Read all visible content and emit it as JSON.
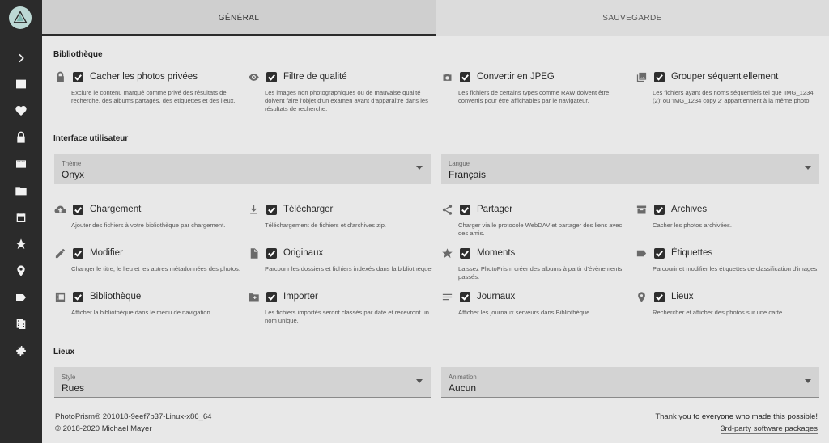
{
  "tabs": [
    {
      "label": "GÉNÉRAL",
      "active": true
    },
    {
      "label": "SAUVEGARDE",
      "active": false
    }
  ],
  "sidebar": {
    "items": [
      "chevron-right-icon",
      "photo-icon",
      "heart-icon",
      "lock-icon",
      "movie-icon",
      "folder-icon",
      "calendar-icon",
      "star-icon",
      "place-icon",
      "label-icon",
      "film-icon",
      "gear-icon"
    ]
  },
  "library": {
    "title": "Bibliothèque",
    "options": [
      {
        "icon": "lock-icon",
        "label": "Cacher les photos privées",
        "checked": true,
        "desc": "Exclure le contenu marqué comme privé des résultats de recherche, des albums partagés, des étiquettes et des lieux."
      },
      {
        "icon": "eye-icon",
        "label": "Filtre de qualité",
        "checked": true,
        "desc": "Les images non photographiques ou de mauvaise qualité doivent faire l'objet d'un examen avant d'apparaître dans les résultats de recherche."
      },
      {
        "icon": "camera-icon",
        "label": "Convertir en JPEG",
        "checked": true,
        "desc": "Les fichiers de certains types comme RAW doivent être convertis pour être affichables par le navigateur."
      },
      {
        "icon": "photo-library-icon",
        "label": "Grouper séquentiellement",
        "checked": true,
        "desc": "Les fichiers ayant des noms séquentiels tel que 'IMG_1234 (2)' ou 'IMG_1234 copy 2' appartiennent à la même photo."
      }
    ]
  },
  "ui": {
    "title": "Interface utilisateur",
    "theme": {
      "label": "Thème",
      "value": "Onyx"
    },
    "language": {
      "label": "Langue",
      "value": "Français"
    },
    "options": [
      {
        "icon": "cloud-upload-icon",
        "label": "Chargement",
        "checked": true,
        "desc": "Ajouter des fichiers à votre bibliothèque par chargement."
      },
      {
        "icon": "download-icon",
        "label": "Télécharger",
        "checked": true,
        "desc": "Téléchargement de fichiers et d'archives zip."
      },
      {
        "icon": "share-icon",
        "label": "Partager",
        "checked": true,
        "desc": "Charger via le protocole WebDAV et partager des liens avec des amis."
      },
      {
        "icon": "archive-icon",
        "label": "Archives",
        "checked": true,
        "desc": "Cacher les photos archivées."
      },
      {
        "icon": "edit-icon",
        "label": "Modifier",
        "checked": true,
        "desc": "Changer le titre, le lieu et les autres métadonnées des photos."
      },
      {
        "icon": "file-icon",
        "label": "Originaux",
        "checked": true,
        "desc": "Parcourir les dossiers et fichiers indexés dans la bibliothèque."
      },
      {
        "icon": "star-icon",
        "label": "Moments",
        "checked": true,
        "desc": "Laissez PhotoPrism créer des albums à partir d'évènements passés."
      },
      {
        "icon": "label-icon",
        "label": "Étiquettes",
        "checked": true,
        "desc": "Parcourir et modifier les étiquettes de classification d'images."
      },
      {
        "icon": "library-icon",
        "label": "Bibliothèque",
        "checked": true,
        "desc": "Afficher la bibliothèque dans le menu de navigation."
      },
      {
        "icon": "folder-add-icon",
        "label": "Importer",
        "checked": true,
        "desc": "Les fichiers importés seront classés par date et recevront un nom unique."
      },
      {
        "icon": "list-icon",
        "label": "Journaux",
        "checked": true,
        "desc": "Afficher les journaux serveurs dans Bibliothèque."
      },
      {
        "icon": "place-icon",
        "label": "Lieux",
        "checked": true,
        "desc": "Rechercher et afficher des photos sur une carte."
      }
    ]
  },
  "places": {
    "title": "Lieux",
    "style": {
      "label": "Style",
      "value": "Rues"
    },
    "animation": {
      "label": "Animation",
      "value": "Aucun"
    }
  },
  "footer": {
    "version": "PhotoPrism® 201018-9eef7b37-Linux-x86_64",
    "copyright": "© 2018-2020 Michael Mayer",
    "thanks_prefix": "Thank you ",
    "thanks_link": "to everyone who made this possible!",
    "packages": "3rd-party software packages"
  }
}
